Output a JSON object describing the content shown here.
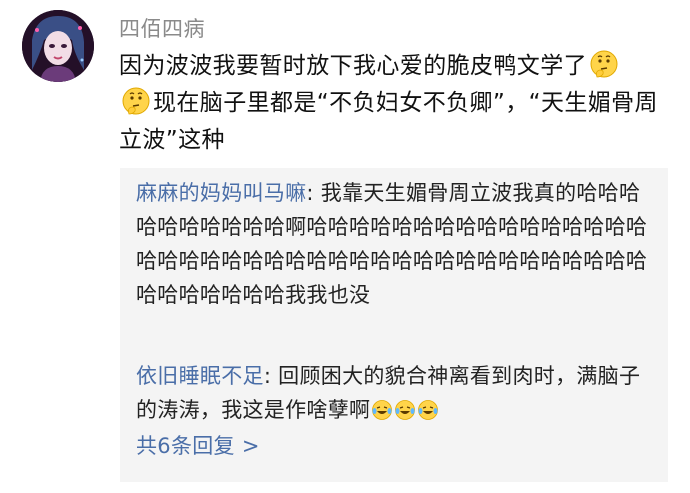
{
  "post": {
    "username": "四佰四病",
    "text_part1": "因为波波我要暂时放下我心爱的脆皮鸭文学了",
    "text_part2": "现在脑子里都是“不负妇女不负卿”，“天生媚骨周立波”这种",
    "emoji": "thinking-face-icon"
  },
  "replies": [
    {
      "author": "麻麻的妈妈叫马嘛",
      "text": "我靠天生媚骨周立波我真的哈哈哈哈哈哈哈哈哈哈啊哈哈哈哈哈哈哈哈哈哈哈哈哈哈哈哈哈哈哈哈哈哈哈哈哈哈哈哈哈哈哈哈哈哈哈哈哈哈哈哈哈哈哈哈哈哈哈我我也没"
    },
    {
      "author": "依旧睡眠不足",
      "text": "回顾困大的貌合神离看到肉时，满脑子的涛涛，我这是作啥孽啊",
      "emoji": "laughing-crying-face-icon"
    }
  ],
  "more_link": "共6条回复 >",
  "colors": {
    "author": "#4a6ea8",
    "username": "#8a8a8a",
    "reply_bg": "#f4f4f4"
  }
}
